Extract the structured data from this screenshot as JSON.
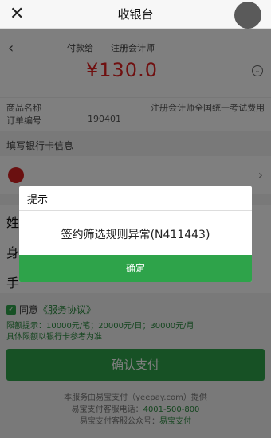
{
  "topbar": {
    "title": "收银台",
    "close_icon": "close-icon"
  },
  "header": {
    "payto_prefix": "付款给",
    "payto_suffix": "注册会计师",
    "amount": "¥130.0",
    "back_icon": "chevron-left-icon"
  },
  "info": {
    "product_label": "商品名称",
    "product_value": "注册会计师全国统一考试费用",
    "order_label": "订单编号",
    "order_value": "190401"
  },
  "card": {
    "section_title": "填写银行卡信息"
  },
  "form": {
    "name_label": "姓",
    "id_label": "身",
    "phone_label": "手"
  },
  "agree": {
    "prefix": "同意",
    "link": "《服务协议》"
  },
  "limits": {
    "line1": "限额提示：10000元/笔；20000元/日；30000元/月",
    "line2": "具体限额以银行卡参考为准"
  },
  "pay_button": "确认支付",
  "footer": {
    "line1": "本服务由易宝支付（yeepay.com）提供",
    "line2_prefix": "易宝支付客服电话：",
    "line2_phone": "4001-500-800",
    "line3_prefix": "易宝支付客服公众号：",
    "line3_account": "易宝支付"
  },
  "dialog": {
    "title": "提示",
    "message": "签约筛选规则异常(N411443)",
    "ok": "确定"
  },
  "colors": {
    "accent": "#2ea34a",
    "amount": "#e02020"
  }
}
